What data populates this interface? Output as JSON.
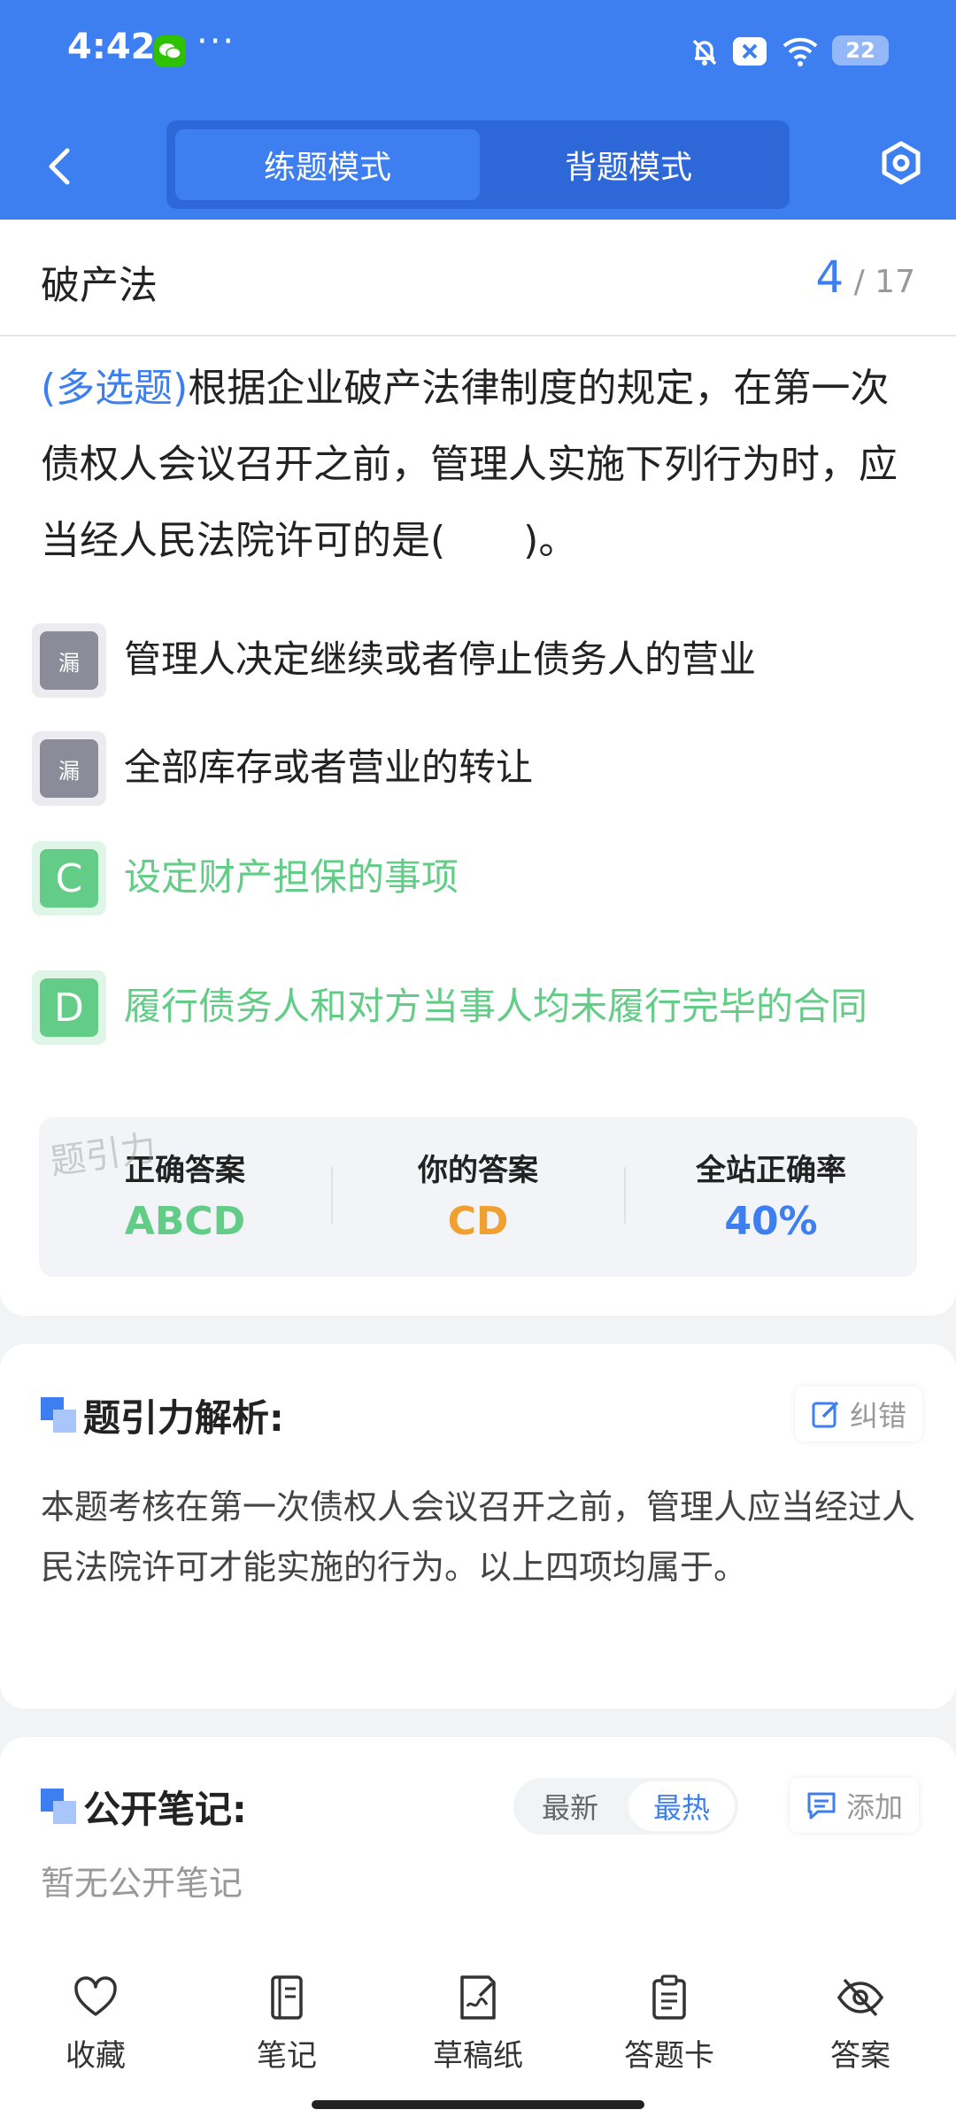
{
  "status_bar": {
    "time": "4:42",
    "dots": "···",
    "battery": "22"
  },
  "header": {
    "tabs": [
      {
        "label": "练题模式",
        "active": true
      },
      {
        "label": "背题模式",
        "active": false
      }
    ],
    "back_icon": "back-chevron-icon",
    "settings_icon": "hexagon-settings-icon",
    "accent_color": "#3d7ff0"
  },
  "question_card": {
    "subject": "破产法",
    "current": "4",
    "total": "/ 17",
    "type_label": "(多选题)",
    "text": "根据企业破产法律制度的规定，在第一次债权人会议召开之前，管理人实施下列行为时，应当经人民法院许可的是(　　)。",
    "options": [
      {
        "badge": "漏",
        "text": "管理人决定继续或者停止债务人的营业",
        "state": "missed"
      },
      {
        "badge": "漏",
        "text": "全部库存或者营业的转让",
        "state": "missed"
      },
      {
        "badge": "C",
        "text": "设定财产担保的事项",
        "state": "correct"
      },
      {
        "badge": "D",
        "text": "履行债务人和对方当事人均未履行完毕的合同",
        "state": "correct"
      }
    ],
    "watermark": "题引力",
    "stats": [
      {
        "label": "正确答案",
        "value": "ABCD",
        "color": "#63cc86"
      },
      {
        "label": "你的答案",
        "value": "CD",
        "color": "#f0a030"
      },
      {
        "label": "全站正确率",
        "value": "40%",
        "color": "#3d7ff0"
      }
    ]
  },
  "analysis": {
    "title": "题引力解析:",
    "correction_label": "纠错",
    "text": "本题考核在第一次债权人会议召开之前，管理人应当经过人民法院许可才能实施的行为。以上四项均属于。"
  },
  "notes": {
    "title": "公开笔记:",
    "sort_options": [
      "最新",
      "最热"
    ],
    "active_sort": "最热",
    "add_label": "添加",
    "empty_text": "暂无公开笔记"
  },
  "bottom_nav": [
    {
      "label": "收藏",
      "icon": "heart-icon"
    },
    {
      "label": "笔记",
      "icon": "notebook-icon"
    },
    {
      "label": "草稿纸",
      "icon": "draft-paper-icon"
    },
    {
      "label": "答题卡",
      "icon": "answer-card-icon"
    },
    {
      "label": "答案",
      "icon": "eye-off-icon"
    }
  ]
}
